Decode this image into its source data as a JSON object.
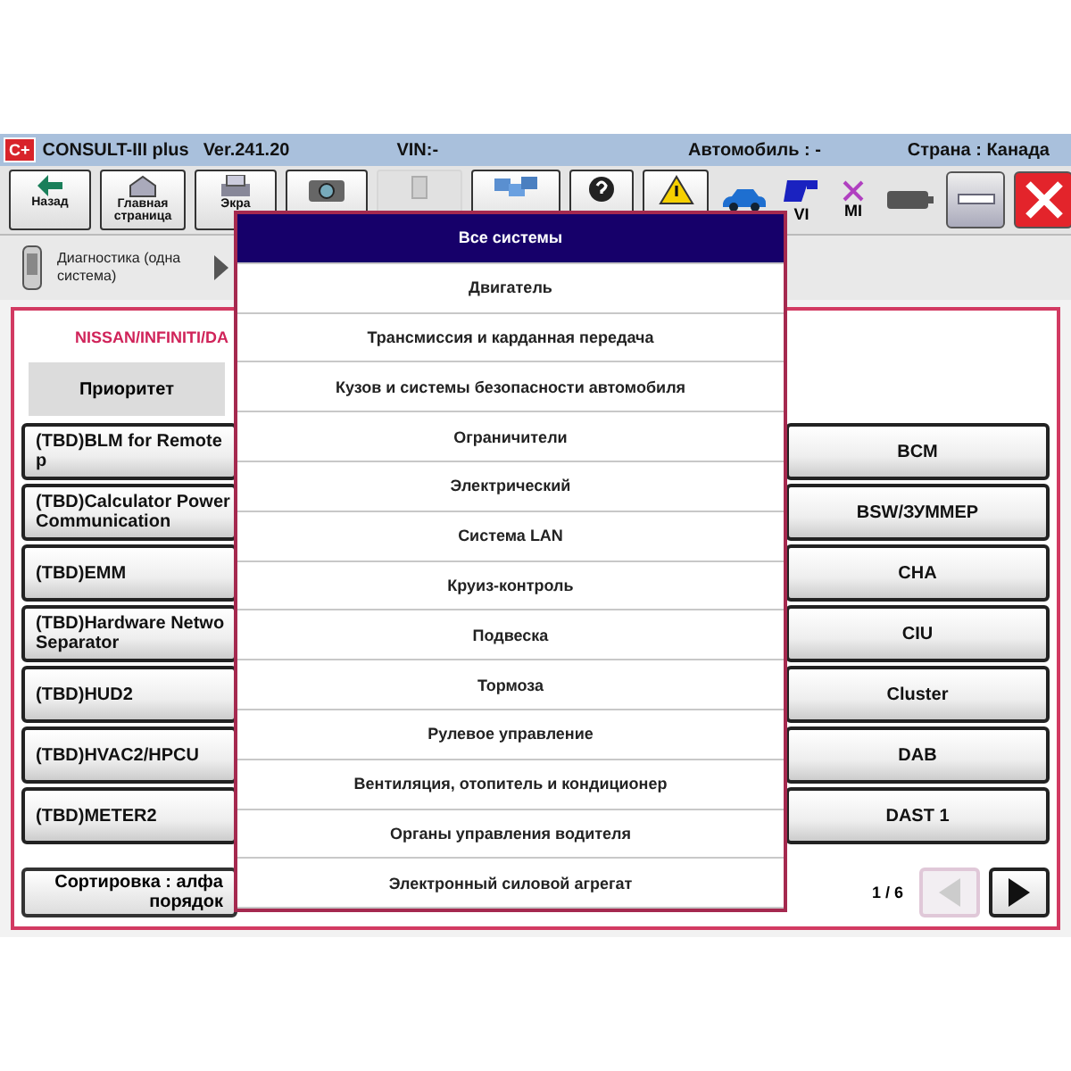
{
  "title_bar": {
    "logo": "C+",
    "app": "CONSULT-III plus",
    "version": "Ver.241.20",
    "vin": "VIN:-",
    "vehicle": "Автомобиль : -",
    "country": "Страна : Канада"
  },
  "toolbar": [
    {
      "kind": "back",
      "label": "Назад",
      "disabled": false
    },
    {
      "kind": "home",
      "label": "Главная страница",
      "disabled": false
    },
    {
      "kind": "print",
      "label": "Экра",
      "disabled": false
    },
    {
      "kind": "camera",
      "disabled": false
    },
    {
      "kind": "mode",
      "disabled": true
    },
    {
      "kind": "network",
      "disabled": false
    },
    {
      "kind": "help",
      "disabled": false
    },
    {
      "kind": "warning",
      "disabled": false
    }
  ],
  "status_icons": [
    {
      "kind": "car"
    },
    {
      "kind": "vi",
      "label": "VI"
    },
    {
      "kind": "mi",
      "label": "MI"
    },
    {
      "kind": "battery"
    }
  ],
  "breadcrumb": {
    "label": "Диагностика (одна система)"
  },
  "panel": {
    "brand": "NISSAN/INFINITI/DA",
    "tab": "Приоритет",
    "left_systems": [
      "(TBD)BLM for Remote p",
      "(TBD)Calculator Power\nCommunication",
      "(TBD)EMM",
      "(TBD)Hardware Netwo\nSeparator",
      "(TBD)HUD2",
      "(TBD)HVAC2/HPCU",
      "(TBD)METER2"
    ],
    "right_systems": [
      "BCM",
      "BSW/ЗУММЕР",
      "CHA",
      "CIU",
      "Cluster",
      "DAB",
      "DAST 1"
    ],
    "sort": "Сортировка : алфа\nпорядок",
    "pager": {
      "page": "1 / 6",
      "prev_disabled": true,
      "next_disabled": false
    }
  },
  "menu": [
    {
      "label": "Все системы",
      "selected": true
    },
    {
      "label": "Двигатель",
      "selected": false
    },
    {
      "label": "Трансмиссия и карданная передача",
      "selected": false
    },
    {
      "label": "Кузов и системы безопасности автомобиля",
      "selected": false
    },
    {
      "label": "Ограничители",
      "selected": false
    },
    {
      "label": "Электрический",
      "selected": false
    },
    {
      "label": "Система LAN",
      "selected": false
    },
    {
      "label": "Круиз-контроль",
      "selected": false
    },
    {
      "label": "Подвеска",
      "selected": false
    },
    {
      "label": "Тормоза",
      "selected": false
    },
    {
      "label": "Рулевое управление",
      "selected": false
    },
    {
      "label": "Вентиляция, отопитель и кондиционер",
      "selected": false
    },
    {
      "label": "Органы управления водителя",
      "selected": false
    },
    {
      "label": "Электронный силовой агрегат",
      "selected": false
    }
  ]
}
